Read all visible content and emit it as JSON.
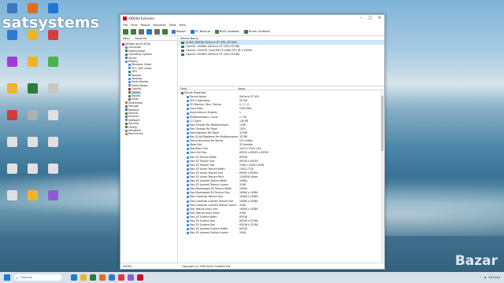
{
  "watermark": "satsystems",
  "corner_mark": "Bazar",
  "desktop_icons": [
    {
      "label": "",
      "color": "#3a77c4"
    },
    {
      "label": "",
      "color": "#e36c1e"
    },
    {
      "label": "",
      "color": "#1e78d6"
    },
    {
      "label": "",
      "color": "#2f7bd1"
    },
    {
      "label": "",
      "color": "#f0b429"
    },
    {
      "label": "",
      "color": "#d63c3c"
    },
    {
      "label": "",
      "color": "#a33ad6"
    },
    {
      "label": "",
      "color": "#f0b429"
    },
    {
      "label": "",
      "color": "#4caf50"
    },
    {
      "label": "",
      "color": "#f0b429"
    },
    {
      "label": "",
      "color": "#2a7d3a"
    },
    {
      "label": "",
      "color": "#c8c8c8"
    },
    {
      "label": "",
      "color": "#d23c3c"
    },
    {
      "label": "",
      "color": "#b0b0b0"
    },
    {
      "label": "",
      "color": "#e0e0e0"
    },
    {
      "label": "",
      "color": "#e0e0e0"
    },
    {
      "label": "",
      "color": "#e0e0e0"
    },
    {
      "label": "",
      "color": "#e0e0e0"
    },
    {
      "label": "",
      "color": "#e0e0e0"
    },
    {
      "label": "",
      "color": "#e0e0e0"
    },
    {
      "label": "",
      "color": "#e0e0e0"
    },
    {
      "label": "",
      "color": "#e0e0e0"
    },
    {
      "label": "",
      "color": "#f0b429"
    },
    {
      "label": "",
      "color": "#8e5cd6"
    }
  ],
  "window": {
    "title": "AIDA64 Extreme",
    "menu": [
      "File",
      "View",
      "Report",
      "Favorites",
      "Tools",
      "Help"
    ],
    "toolbar": [
      {
        "label": "Report",
        "color": "#3a77c4"
      },
      {
        "label": "PC Backup",
        "color": "#1e78d6"
      },
      {
        "label": "BIOS Updates",
        "color": "#3f7d3b"
      },
      {
        "label": "Driver Updates",
        "color": "#3f7d3b"
      }
    ],
    "tabs": [
      "Menu",
      "Favorites"
    ],
    "tree": [
      {
        "label": "AIDA64 v6.92.6700",
        "color": "#c8102e",
        "indent": 0
      },
      {
        "label": "Computer",
        "color": "#4a8fd6",
        "indent": 1
      },
      {
        "label": "Motherboard",
        "color": "#3f7d3b",
        "indent": 1
      },
      {
        "label": "Operating System",
        "color": "#1e78d6",
        "indent": 1
      },
      {
        "label": "Server",
        "color": "#6b6b6b",
        "indent": 1
      },
      {
        "label": "Display",
        "color": "#4a8fd6",
        "indent": 1
      },
      {
        "label": "Windows Video",
        "color": "#4a8fd6",
        "indent": 2
      },
      {
        "label": "PCI / AGP Video",
        "color": "#4a8fd6",
        "indent": 2
      },
      {
        "label": "GPU",
        "color": "#3f7d3b",
        "indent": 2
      },
      {
        "label": "Monitor",
        "color": "#4a8fd6",
        "indent": 2
      },
      {
        "label": "Desktop",
        "color": "#4a8fd6",
        "indent": 2
      },
      {
        "label": "Multi-Monitor",
        "color": "#4a8fd6",
        "indent": 2
      },
      {
        "label": "Video Modes",
        "color": "#4a8fd6",
        "indent": 2
      },
      {
        "label": "OpenGL",
        "color": "#c8102e",
        "indent": 2
      },
      {
        "label": "GPGPU",
        "color": "#3f7d3b",
        "indent": 2,
        "selected": true
      },
      {
        "label": "Mantle",
        "color": "#6b6b6b",
        "indent": 2
      },
      {
        "label": "Fonts",
        "color": "#6b6b6b",
        "indent": 2
      },
      {
        "label": "Multimedia",
        "color": "#e36c1e",
        "indent": 1
      },
      {
        "label": "Storage",
        "color": "#6b6b6b",
        "indent": 1
      },
      {
        "label": "Network",
        "color": "#1e78d6",
        "indent": 1
      },
      {
        "label": "DirectX",
        "color": "#3f7d3b",
        "indent": 1
      },
      {
        "label": "Devices",
        "color": "#6b6b6b",
        "indent": 1
      },
      {
        "label": "Software",
        "color": "#4a8fd6",
        "indent": 1
      },
      {
        "label": "Security",
        "color": "#3f7d3b",
        "indent": 1
      },
      {
        "label": "Config",
        "color": "#6b6b6b",
        "indent": 1
      },
      {
        "label": "Database",
        "color": "#4a8fd6",
        "indent": 1
      },
      {
        "label": "Benchmark",
        "color": "#e36c1e",
        "indent": 1
      }
    ],
    "device_header": "Device Name",
    "devices": [
      "CUDA: NVIDIA GeForce GT 430 (GF108)",
      "OpenCL: NVIDIA GeForce GT 430 (GF108)",
      "OpenCL: Intel(R) Core(TM) i5-4460 CPU @ 3.20GHz",
      "OpenCL: NVIDIA GeForce GT 430 (GF108)"
    ],
    "col_field": "Field",
    "col_value": "Value",
    "section": "Device Properties",
    "rows": [
      [
        "Device Name",
        "GeForce GT 430"
      ],
      [
        "GPU Code Name",
        "GF108"
      ],
      [
        "PCI Domain / Bus / Device",
        "0 / 1 / 0"
      ],
      [
        "Clock Rate",
        "1400 MHz"
      ],
      [
        "Asynchronous Engines",
        "1"
      ],
      [
        "Multiprocessors / Cores",
        "2 / 96"
      ],
      [
        "L2 Cache",
        "128 KB"
      ],
      [
        "Max Threads Per Multiprocessor",
        "1536"
      ],
      [
        "Max Threads Per Block",
        "1024"
      ],
      [
        "Max Registers Per Block",
        "32768"
      ],
      [
        "Max 32-bit Registers Per Multiprocessor",
        "32768"
      ],
      [
        "Max Instructions Per Kernel",
        "512 million"
      ],
      [
        "Warp Size",
        "32 threads"
      ],
      [
        "Max Block Size",
        "1024 x 1024 x 64"
      ],
      [
        "Max Grid Size",
        "65535 x 65535 x 65535"
      ],
      [
        "Max 1D Texture Width",
        "65536"
      ],
      [
        "Max 2D Texture Size",
        "65536 x 65535"
      ],
      [
        "Max 3D Texture Size",
        "2048 x 2048 x 2048"
      ],
      [
        "Max 1D Linear Texture Width",
        "134217728"
      ],
      [
        "Max 2D Linear Texture Size",
        "65000 x 65000"
      ],
      [
        "Max 2D Linear Texture Pitch",
        "1048544 bytes"
      ],
      [
        "Max 1D Layered Texture Width",
        "16384"
      ],
      [
        "Max 1D Layered Texture Layers",
        "2048"
      ],
      [
        "Max Mipmapped 1D Texture Width",
        "16384"
      ],
      [
        "Max Mipmapped 2D Texture Size",
        "16384 x 16384"
      ],
      [
        "Max Cubemap Texture Size",
        "16384 x 16384"
      ],
      [
        "Max Cubemap Layered Texture Size",
        "16384 x 16384"
      ],
      [
        "Max Cubemap Layered Texture Layers",
        "2046"
      ],
      [
        "Max Texture Array Size",
        "16384 x 16384"
      ],
      [
        "Max Texture Array Slices",
        "2048"
      ],
      [
        "Max 1D Surface Width",
        "65536"
      ],
      [
        "Max 2D Surface Size",
        "65536 x 32768"
      ],
      [
        "Max 3D Surface Size",
        "65536 x 32768"
      ],
      [
        "Max 1D Layered Surface Width",
        "65536"
      ],
      [
        "Max 1D Layered Surface Layers",
        "2048"
      ]
    ],
    "status_left": "GPGPU",
    "status_mid": "Copyright (c) 1995-2024 FinalWire Ltd."
  },
  "taskbar": {
    "search_placeholder": "Търсене",
    "apps": [
      {
        "color": "#1e78d6"
      },
      {
        "color": "#f0b429"
      },
      {
        "color": "#2a7d3a"
      },
      {
        "color": "#e36c1e"
      },
      {
        "color": "#3a77c4"
      },
      {
        "color": "#d63c3c"
      },
      {
        "color": "#8e5cd6"
      },
      {
        "color": "#c8102e"
      }
    ],
    "time": "",
    "date": "1.8.2024"
  }
}
